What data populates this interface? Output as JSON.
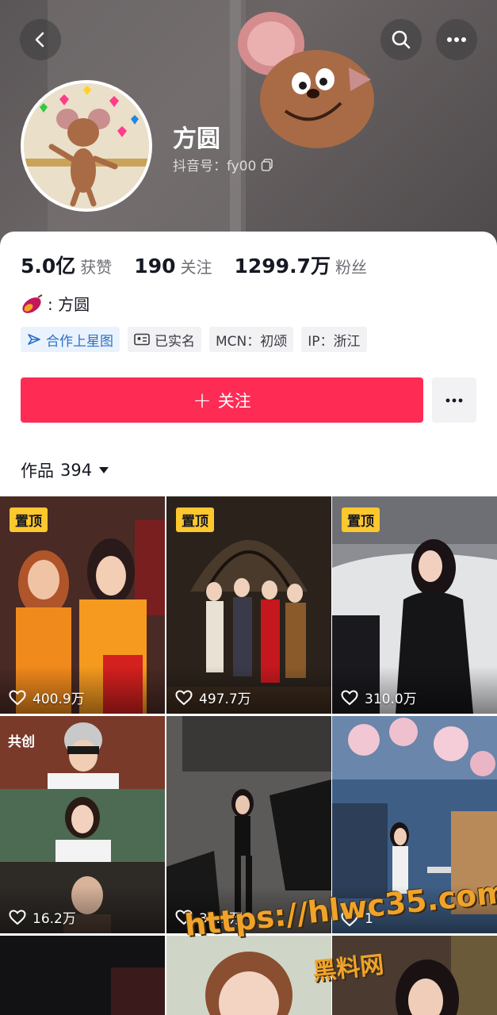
{
  "header": {
    "nickname": "方圆",
    "douyin_id": "抖音号：fy00"
  },
  "stats": [
    {
      "num": "5.0亿",
      "label": "获赞"
    },
    {
      "num": "190",
      "label": "关注"
    },
    {
      "num": "1299.7万",
      "label": "粉丝"
    }
  ],
  "bio": ": 方圆",
  "tags": [
    "合作上星图",
    "已实名",
    "MCN：初颂",
    "IP：浙江"
  ],
  "follow_label": "关注",
  "works": {
    "label": "作品",
    "count": "394"
  },
  "tiles": [
    {
      "badge": "置顶",
      "likes": "400.9万"
    },
    {
      "badge": "置顶",
      "likes": "497.7万"
    },
    {
      "badge": "置顶",
      "likes": "310.0万"
    },
    {
      "badge": "共创",
      "likes": "16.2万"
    },
    {
      "badge": "",
      "likes": "33.1万"
    },
    {
      "badge": "",
      "likes": "1"
    }
  ],
  "watermark": {
    "line1": "https://hlwc35.com",
    "line2": "黑料网"
  },
  "colors": {
    "accent": "#fe2c55",
    "pin": "#fdc72e",
    "tag_blue": "#2b6fc4"
  },
  "icons": [
    "back-icon",
    "search-icon",
    "more-icon",
    "copy-icon",
    "sweet-potato-icon",
    "star-map-icon",
    "id-card-icon",
    "heart-icon",
    "caret-down-icon"
  ]
}
